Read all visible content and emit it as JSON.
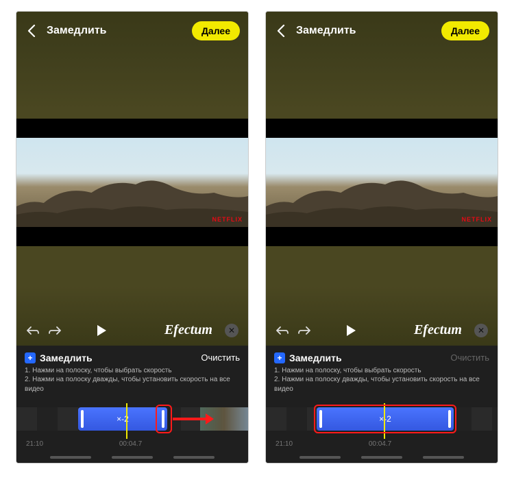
{
  "header": {
    "title": "Замедлить",
    "next_label": "Далее"
  },
  "brand": "Efectum",
  "watermark": "NETFLIX",
  "panel": {
    "title": "Замедлить",
    "clear_label": "Очистить",
    "hint1": "1. Нажми на полоску, чтобы выбрать скорость",
    "hint2": "2. Нажми на полоску дважды, чтобы установить скорость на все видео"
  },
  "segment": {
    "speed_label": "×-2"
  },
  "times": {
    "total": "21:10",
    "current": "00:04.7"
  },
  "screens": {
    "left": {
      "clear_enabled": true
    },
    "right": {
      "clear_enabled": false
    }
  }
}
